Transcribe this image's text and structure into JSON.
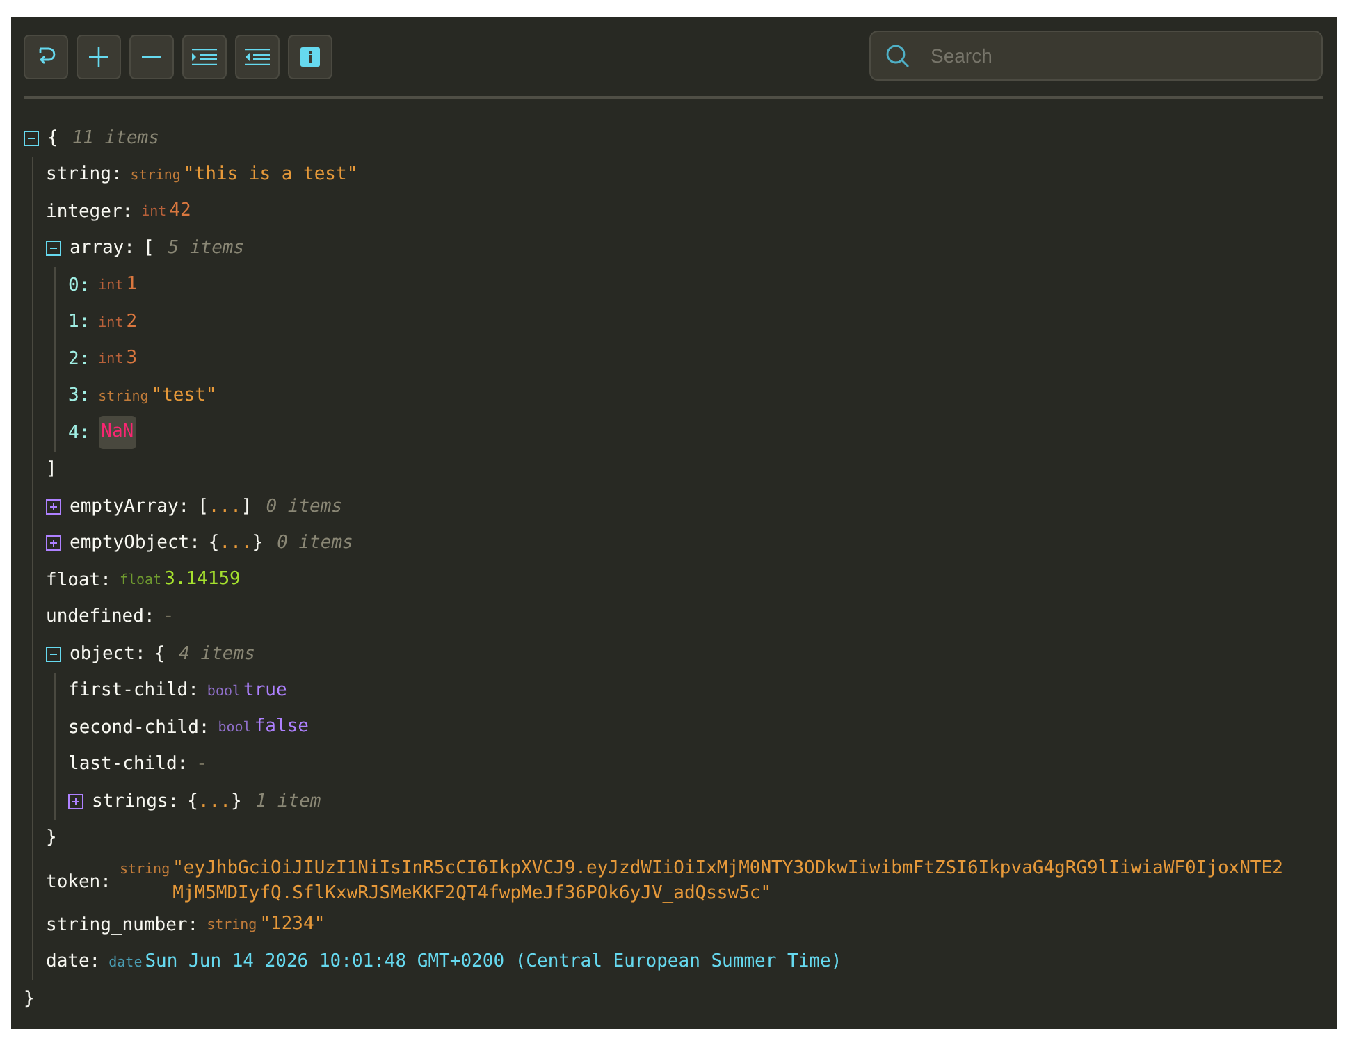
{
  "toolbar": {
    "buttons": [
      {
        "kind": "refresh"
      },
      {
        "kind": "expand"
      },
      {
        "kind": "collapse"
      },
      {
        "kind": "indent"
      },
      {
        "kind": "outdent"
      },
      {
        "kind": "info"
      }
    ]
  },
  "search": {
    "placeholder": "Search"
  },
  "tree": {
    "kind": "object",
    "expanded": true,
    "open": "{",
    "close": "}",
    "count": "11 items",
    "children": [
      {
        "key": "string:",
        "kind": "string",
        "type_label": "string",
        "value": "\"this is a test\""
      },
      {
        "key": "integer:",
        "kind": "int",
        "type_label": "int",
        "value": "42"
      },
      {
        "key": "array:",
        "kind": "array",
        "expanded": true,
        "open": "[",
        "close": "]",
        "count": "5 items",
        "children": [
          {
            "key": "0:",
            "kind": "int",
            "type_label": "int",
            "value": "1"
          },
          {
            "key": "1:",
            "kind": "int",
            "type_label": "int",
            "value": "2"
          },
          {
            "key": "2:",
            "kind": "int",
            "type_label": "int",
            "value": "3"
          },
          {
            "key": "3:",
            "kind": "string",
            "type_label": "string",
            "value": "\"test\""
          },
          {
            "key": "4:",
            "kind": "nan",
            "value": "NaN"
          }
        ]
      },
      {
        "key": "emptyArray:",
        "kind": "array",
        "expanded": false,
        "open": "[",
        "ellipsis": "...",
        "close": "]",
        "count": "0 items"
      },
      {
        "key": "emptyObject:",
        "kind": "object",
        "expanded": false,
        "open": "{",
        "ellipsis": "...",
        "close": "}",
        "count": "0 items"
      },
      {
        "key": "float:",
        "kind": "float",
        "type_label": "float",
        "value": "3.14159"
      },
      {
        "key": "undefined:",
        "kind": "undefined",
        "value": "-"
      },
      {
        "key": "object:",
        "kind": "object",
        "expanded": true,
        "open": "{",
        "close": "}",
        "count": "4 items",
        "children": [
          {
            "key": "first-child:",
            "kind": "bool",
            "type_label": "bool",
            "value": "true"
          },
          {
            "key": "second-child:",
            "kind": "bool",
            "type_label": "bool",
            "value": "false"
          },
          {
            "key": "last-child:",
            "kind": "undefined",
            "value": "-"
          },
          {
            "key": "strings:",
            "kind": "object",
            "expanded": false,
            "open": "{",
            "ellipsis": "...",
            "close": "}",
            "count": "1 item"
          }
        ]
      },
      {
        "key": "token:",
        "kind": "string",
        "type_label": "string",
        "value": "\"eyJhbGciOiJIUzI1NiIsInR5cCI6IkpXVCJ9.eyJzdWIiOiIxMjM0NTY3ODkwIiwibmFtZSI6IkpvaG4gRG9lIiwiaWF0IjoxNTE2MjM5MDIyfQ.SflKxwRJSMeKKF2QT4fwpMeJf36POk6yJV_adQssw5c\""
      },
      {
        "key": "string_number:",
        "kind": "string",
        "type_label": "string",
        "value": "\"1234\""
      },
      {
        "key": "date:",
        "kind": "date",
        "type_label": "date",
        "value": "Sun Jun 14 2026 10:01:48 GMT+0200 (Central European Summer Time)"
      }
    ]
  }
}
